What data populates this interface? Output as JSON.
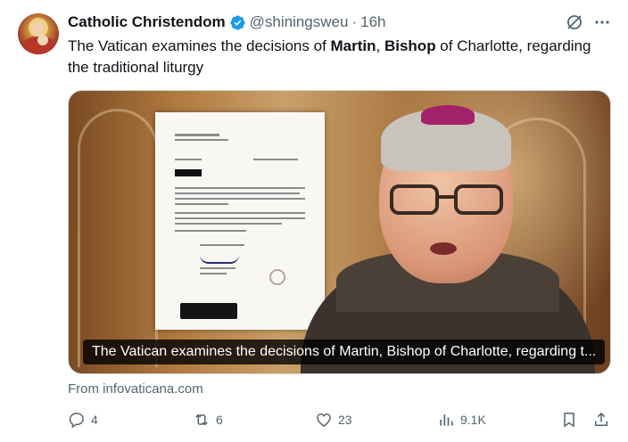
{
  "author": {
    "display_name": "Catholic Christendom",
    "handle": "@shiningsweu",
    "separator": "·",
    "time": "16h",
    "verified": true
  },
  "tweet": {
    "text_segments": [
      {
        "text": "The Vatican examines the decisions of ",
        "bold": false
      },
      {
        "text": "Martin",
        "bold": true
      },
      {
        "text": ", ",
        "bold": false
      },
      {
        "text": "Bishop",
        "bold": true
      },
      {
        "text": " of Charlotte, regarding the traditional liturgy",
        "bold": false
      }
    ]
  },
  "media": {
    "caption": "The Vatican examines the decisions of Martin, Bishop of Charlotte, regarding t..."
  },
  "link": {
    "source": "From infovaticana.com"
  },
  "actions": {
    "replies": "4",
    "reposts": "6",
    "likes": "23",
    "views": "9.1K"
  },
  "icons": {
    "verified": "verified-badge-icon",
    "grok": "grok-icon",
    "more": "more-icon",
    "reply": "reply-icon",
    "repost": "repost-icon",
    "like": "heart-icon",
    "views": "views-icon",
    "bookmark": "bookmark-icon",
    "share": "share-icon"
  },
  "colors": {
    "text_primary": "#0f1419",
    "text_secondary": "#536471",
    "verified_blue": "#1d9bf0"
  }
}
